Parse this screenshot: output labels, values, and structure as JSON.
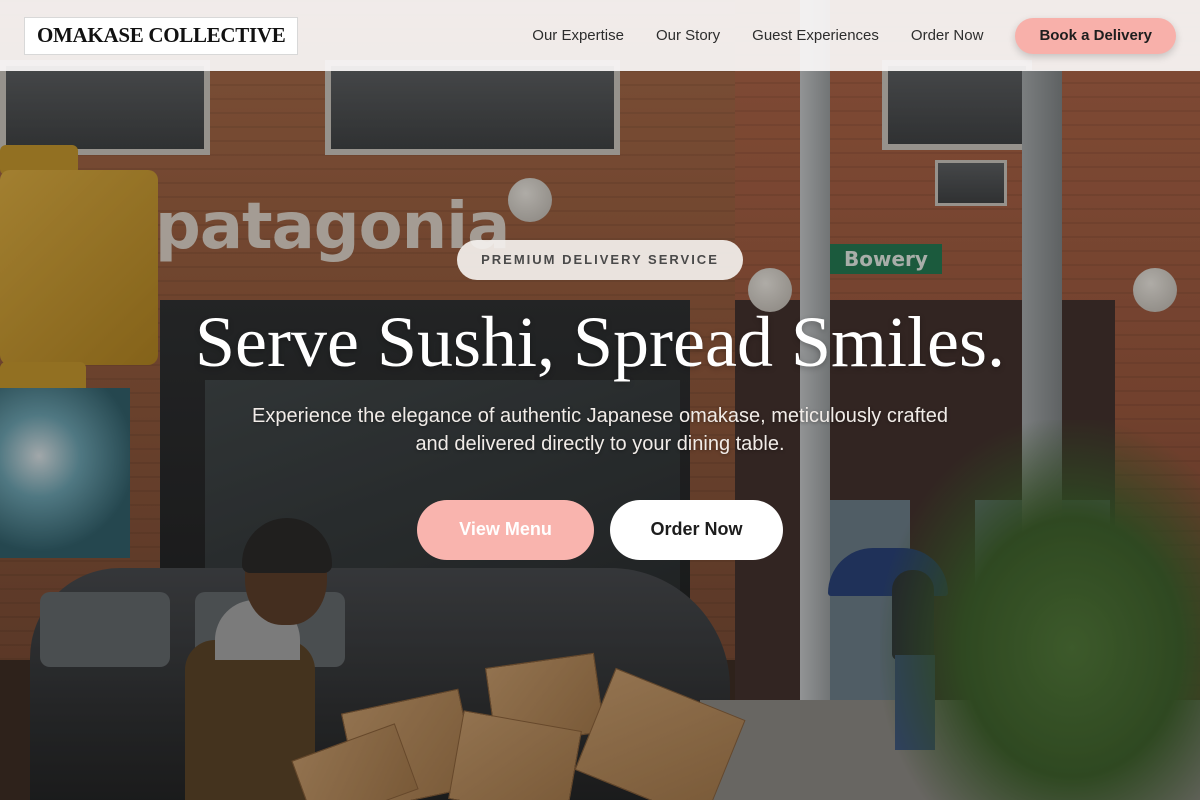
{
  "header": {
    "logo": "OMAKASE COLLECTIVE",
    "nav": [
      {
        "label": "Our Expertise"
      },
      {
        "label": "Our Story"
      },
      {
        "label": "Guest Experiences"
      },
      {
        "label": "Order Now"
      }
    ],
    "cta_label": "Book a Delivery"
  },
  "hero": {
    "badge": "PREMIUM DELIVERY SERVICE",
    "title": "Serve Sushi, Spread Smiles.",
    "subtitle": "Experience the elegance of authentic Japanese omakase, meticulously crafted and delivered directly to your dining table.",
    "primary_button": "View Menu",
    "secondary_button": "Order Now"
  },
  "background": {
    "storefront_sign": "patagonia",
    "street_sign": "Bowery"
  },
  "colors": {
    "accent_pink": "#f8b0aa",
    "header_bg": "#faf8f7",
    "title_text": "#ffffff"
  }
}
